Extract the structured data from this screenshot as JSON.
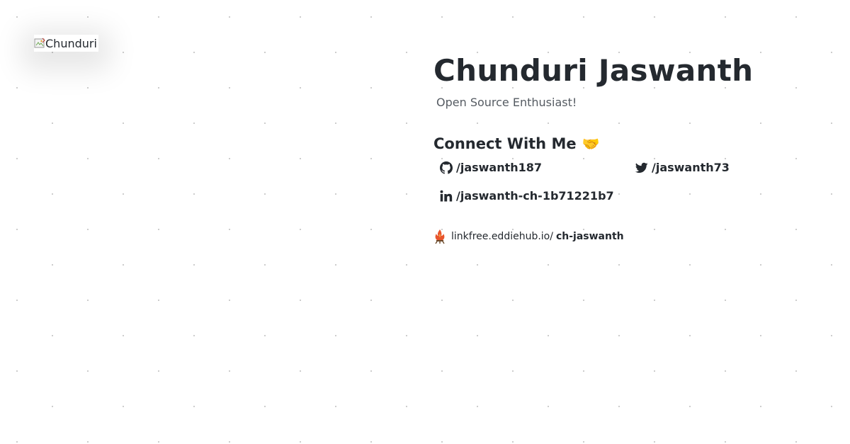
{
  "profile": {
    "avatar_alt": "Chunduri",
    "name": "Chunduri Jaswanth",
    "tagline": "Open Source Enthusiast!"
  },
  "connect": {
    "heading": "Connect With Me",
    "heading_emoji": "🤝",
    "links": [
      {
        "platform": "github",
        "icon": "github-icon",
        "label": "/jaswanth187"
      },
      {
        "platform": "twitter",
        "icon": "twitter-icon",
        "label": "/jaswanth73"
      },
      {
        "platform": "linkedin",
        "icon": "linkedin-icon",
        "label": "/jaswanth-ch-1b71221b7"
      }
    ]
  },
  "linkfree": {
    "icon": "linkfree-icon",
    "domain": "linkfree.eddiehub.io/",
    "handle": "ch-jaswanth"
  },
  "colors": {
    "text": "#24292f",
    "muted": "#555b62",
    "dot": "#c9c9c9",
    "background": "#ffffff"
  }
}
